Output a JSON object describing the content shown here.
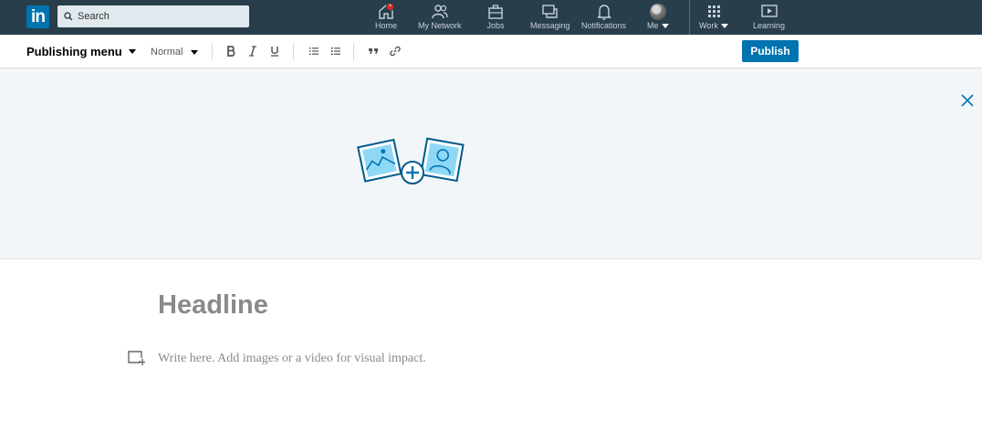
{
  "header": {
    "logo_text": "in",
    "search_placeholder": "Search",
    "nav": [
      {
        "label": "Home",
        "icon": "home-icon"
      },
      {
        "label": "My Network",
        "icon": "network-icon"
      },
      {
        "label": "Jobs",
        "icon": "briefcase-icon"
      },
      {
        "label": "Messaging",
        "icon": "messaging-icon"
      },
      {
        "label": "Notifications",
        "icon": "bell-icon"
      },
      {
        "label": "Me",
        "icon": "avatar"
      },
      {
        "label": "Work",
        "icon": "grid-icon"
      },
      {
        "label": "Learning",
        "icon": "play-icon"
      }
    ],
    "notification_badge": "•"
  },
  "toolbar": {
    "publishing_menu_label": "Publishing menu",
    "style_label": "Normal",
    "publish_label": "Publish"
  },
  "editor": {
    "headline_placeholder": "Headline",
    "body_placeholder": "Write here. Add images or a video for visual impact."
  },
  "colors": {
    "nav_bg": "#283e4a",
    "brand": "#0073b1",
    "cover_bg": "#f3f6f8"
  }
}
